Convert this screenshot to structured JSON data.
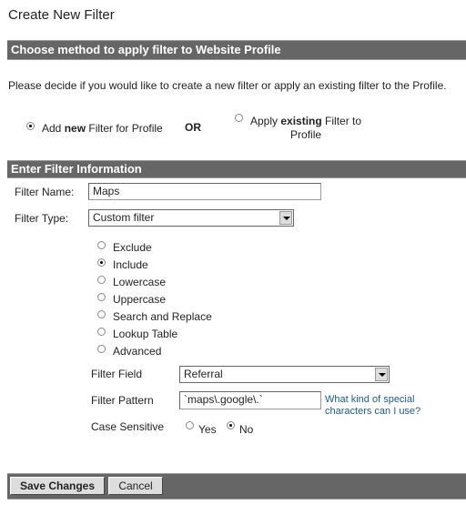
{
  "title": "Create New Filter",
  "section1": {
    "header": "Choose method to apply filter to Website Profile",
    "description": "Please decide if you would like to create a new filter or apply an existing filter to the Profile.",
    "option_new": {
      "pre": "Add ",
      "bold": "new",
      "post": " Filter for Profile",
      "selected": true
    },
    "or_label": "OR",
    "option_existing": {
      "pre": "Apply ",
      "bold": "existing",
      "post": " Filter to",
      "line2": "Profile",
      "selected": false
    }
  },
  "section2": {
    "header": "Enter Filter Information",
    "filter_name_label": "Filter Name:",
    "filter_name_value": "Maps",
    "filter_type_label": "Filter Type:",
    "filter_type_value": "Custom filter",
    "type_options": [
      {
        "label": "Exclude",
        "selected": false
      },
      {
        "label": "Include",
        "selected": true
      },
      {
        "label": "Lowercase",
        "selected": false
      },
      {
        "label": "Uppercase",
        "selected": false
      },
      {
        "label": "Search and Replace",
        "selected": false
      },
      {
        "label": "Lookup Table",
        "selected": false
      },
      {
        "label": "Advanced",
        "selected": false
      }
    ],
    "filter_field_label": "Filter Field",
    "filter_field_value": "Referral",
    "filter_pattern_label": "Filter Pattern",
    "filter_pattern_value": "`maps\\.google\\.`",
    "help_link": "What kind of special characters can I use?",
    "case_label": "Case Sensitive",
    "case_yes": "Yes",
    "case_no": "No",
    "case_selected": "No"
  },
  "footer": {
    "save": "Save Changes",
    "cancel": "Cancel"
  }
}
